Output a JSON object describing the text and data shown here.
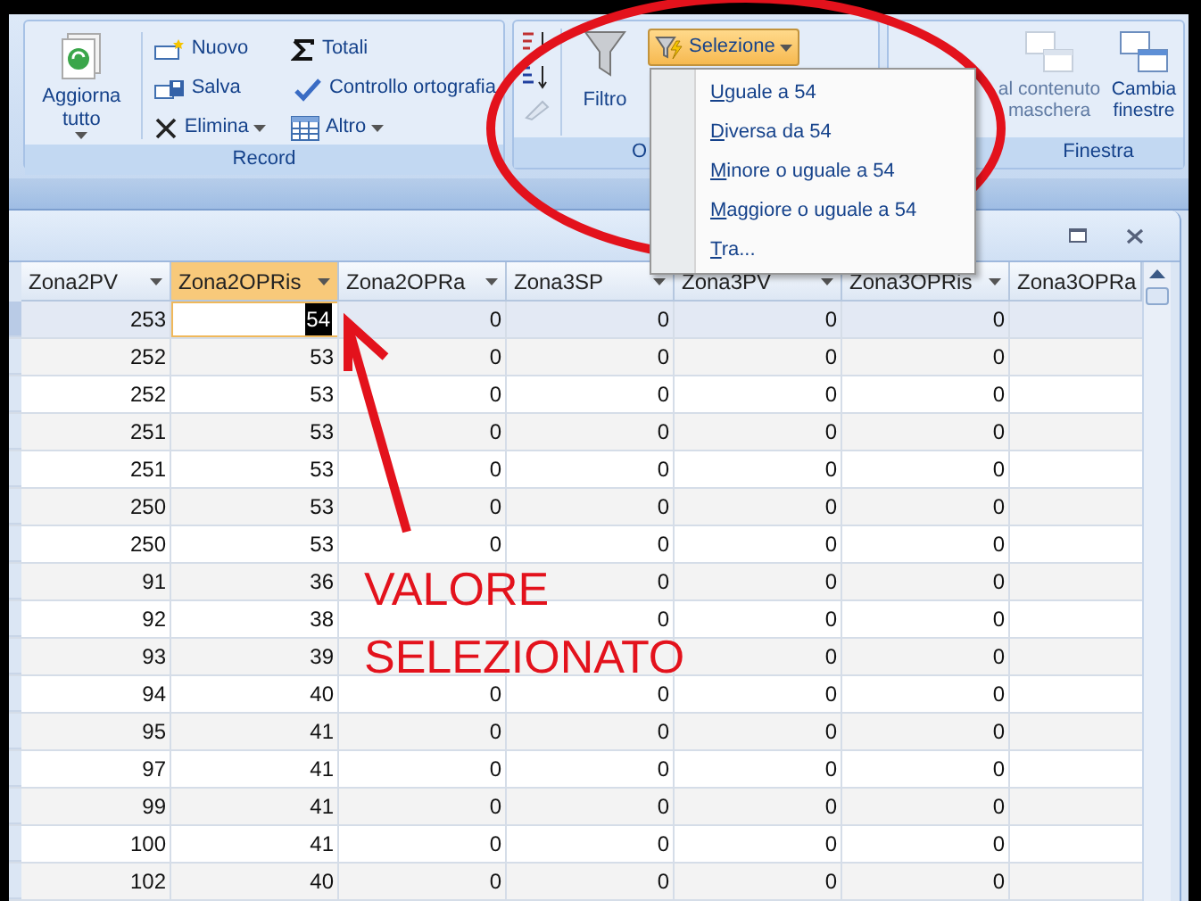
{
  "ribbon": {
    "record_group": {
      "label": "Record",
      "refresh": "Aggiorna tutto",
      "buttons": [
        {
          "kind": "new",
          "label": "Nuovo"
        },
        {
          "kind": "save",
          "label": "Salva"
        },
        {
          "kind": "delete",
          "label": "Elimina",
          "dropdown": true
        },
        {
          "kind": "sum",
          "label": "Totali"
        },
        {
          "kind": "spell",
          "label": "Controllo ortografia"
        },
        {
          "kind": "grid",
          "label": "Altro",
          "dropdown": true
        }
      ]
    },
    "sort_group": {
      "label": "O",
      "filter": "Filtro",
      "selection": {
        "label": "Selezione",
        "open": true
      }
    },
    "window_group": {
      "label": "Finestra",
      "buttons": [
        {
          "label": "al contenuto maschera",
          "disabled": true
        },
        {
          "label": "Cambia finestre",
          "disabled": false
        }
      ]
    }
  },
  "selection_menu": [
    "Uguale a 54",
    "Diversa da 54",
    "Minore o uguale a 54",
    "Maggiore o uguale a 54",
    "Tra..."
  ],
  "table": {
    "columns": [
      {
        "label": "Zona2PV",
        "selected": false
      },
      {
        "label": "Zona2OPRis",
        "selected": true
      },
      {
        "label": "Zona2OPRa",
        "selected": false
      },
      {
        "label": "Zona3SP",
        "selected": false
      },
      {
        "label": "Zona3PV",
        "selected": false
      },
      {
        "label": "Zona3OPRis",
        "selected": false
      },
      {
        "label": "Zona3OPRa",
        "selected": false
      }
    ],
    "rows": [
      {
        "selected": true,
        "cells": [
          "253",
          "54",
          "0",
          "0",
          "0",
          "0"
        ]
      },
      {
        "selected": false,
        "cells": [
          "252",
          "53",
          "0",
          "0",
          "0",
          "0"
        ]
      },
      {
        "selected": false,
        "cells": [
          "252",
          "53",
          "0",
          "0",
          "0",
          "0"
        ]
      },
      {
        "selected": false,
        "cells": [
          "251",
          "53",
          "0",
          "0",
          "0",
          "0"
        ]
      },
      {
        "selected": false,
        "cells": [
          "251",
          "53",
          "0",
          "0",
          "0",
          "0"
        ]
      },
      {
        "selected": false,
        "cells": [
          "250",
          "53",
          "0",
          "0",
          "0",
          "0"
        ]
      },
      {
        "selected": false,
        "cells": [
          "250",
          "53",
          "0",
          "0",
          "0",
          "0"
        ]
      },
      {
        "selected": false,
        "cells": [
          "91",
          "36",
          null,
          "0",
          "0",
          "0"
        ]
      },
      {
        "selected": false,
        "cells": [
          "92",
          "38",
          null,
          "0",
          "0",
          "0"
        ]
      },
      {
        "selected": false,
        "cells": [
          "93",
          "39",
          null,
          null,
          "0",
          "0"
        ]
      },
      {
        "selected": false,
        "cells": [
          "94",
          "40",
          "0",
          "0",
          "0",
          "0"
        ]
      },
      {
        "selected": false,
        "cells": [
          "95",
          "41",
          "0",
          "0",
          "0",
          "0"
        ]
      },
      {
        "selected": false,
        "cells": [
          "97",
          "41",
          "0",
          "0",
          "0",
          "0"
        ]
      },
      {
        "selected": false,
        "cells": [
          "99",
          "41",
          "0",
          "0",
          "0",
          "0"
        ]
      },
      {
        "selected": false,
        "cells": [
          "100",
          "41",
          "0",
          "0",
          "0",
          "0"
        ]
      },
      {
        "selected": false,
        "cells": [
          "102",
          "40",
          "0",
          "0",
          "0",
          "0"
        ]
      }
    ]
  },
  "annotation": {
    "lines": [
      "VALORE",
      "SELEZIONATO"
    ],
    "color": "#e3121c"
  }
}
